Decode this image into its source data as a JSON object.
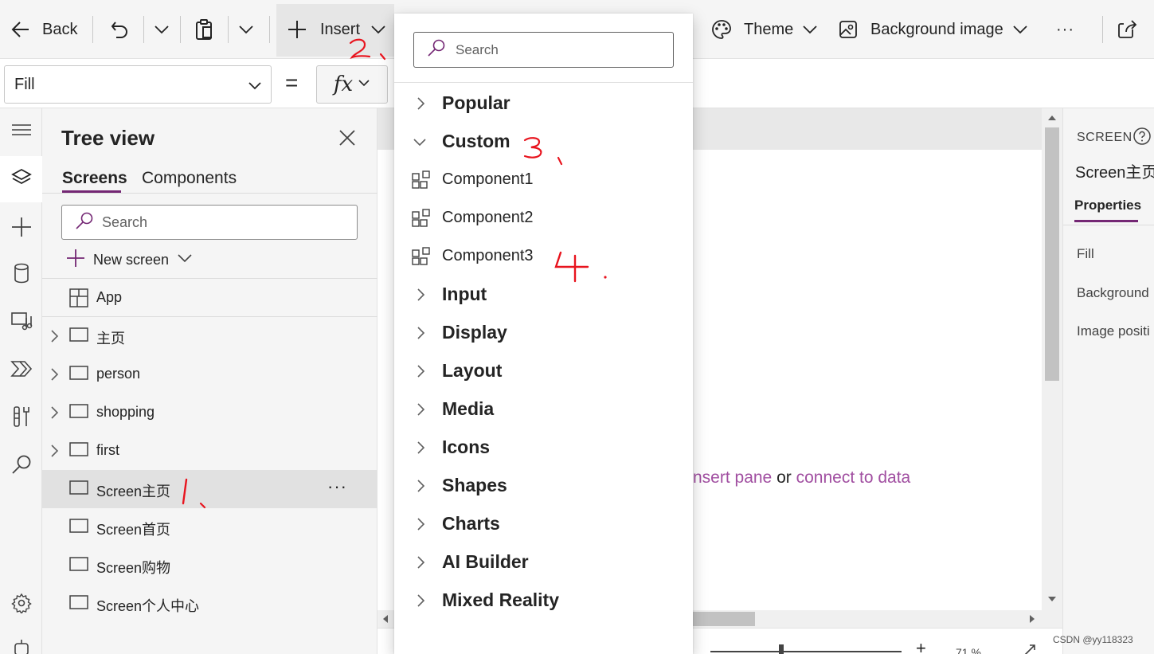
{
  "toolbar": {
    "back_label": "Back",
    "insert_label": "Insert",
    "theme_label": "Theme",
    "background_image_label": "Background image",
    "more_label": "···"
  },
  "formula_bar": {
    "property": "Fill",
    "equals": "=",
    "fx": "fx"
  },
  "tree_view": {
    "title": "Tree view",
    "tabs": [
      {
        "label": "Screens",
        "active": true
      },
      {
        "label": "Components",
        "active": false
      }
    ],
    "search_placeholder": "Search",
    "new_screen_label": "New screen",
    "items": [
      {
        "label": "App",
        "icon": "app-icon",
        "expandable": false
      },
      {
        "label": "主页",
        "icon": "screen-icon",
        "expandable": true
      },
      {
        "label": "person",
        "icon": "screen-icon",
        "expandable": true
      },
      {
        "label": "shopping",
        "icon": "screen-icon",
        "expandable": true
      },
      {
        "label": "first",
        "icon": "screen-icon",
        "expandable": true
      },
      {
        "label": "Screen主页",
        "icon": "screen-icon",
        "expandable": false,
        "selected": true,
        "more": "···"
      },
      {
        "label": "Screen首页",
        "icon": "screen-icon",
        "expandable": false
      },
      {
        "label": "Screen购物",
        "icon": "screen-icon",
        "expandable": false
      },
      {
        "label": "Screen个人中心",
        "icon": "screen-icon",
        "expandable": false
      }
    ]
  },
  "insert_menu": {
    "search_placeholder": "Search",
    "categories": [
      {
        "label": "Popular",
        "expanded": false
      },
      {
        "label": "Custom",
        "expanded": true,
        "children": [
          "Component1",
          "Component2",
          "Component3"
        ]
      },
      {
        "label": "Input",
        "expanded": false
      },
      {
        "label": "Display",
        "expanded": false
      },
      {
        "label": "Layout",
        "expanded": false
      },
      {
        "label": "Media",
        "expanded": false
      },
      {
        "label": "Icons",
        "expanded": false
      },
      {
        "label": "Shapes",
        "expanded": false
      },
      {
        "label": "Charts",
        "expanded": false
      },
      {
        "label": "AI Builder",
        "expanded": false
      },
      {
        "label": "Mixed Reality",
        "expanded": false
      }
    ]
  },
  "canvas": {
    "message_link1": "nsert pane",
    "message_or": "or",
    "message_link2": "connect to data",
    "zoom_plus": "+",
    "zoom_value": "71 %"
  },
  "properties_panel": {
    "kind": "SCREEN",
    "screen_name": "Screen主页",
    "tab": "Properties",
    "labels": [
      "Fill",
      "Background",
      "Image positi"
    ]
  },
  "annotations": [
    "2、",
    "3、",
    "4、",
    "1、"
  ],
  "watermark": "CSDN @yy118323",
  "colors": {
    "accent": "#742774",
    "link": "#a14fa1",
    "annotation": "#e8141e"
  }
}
